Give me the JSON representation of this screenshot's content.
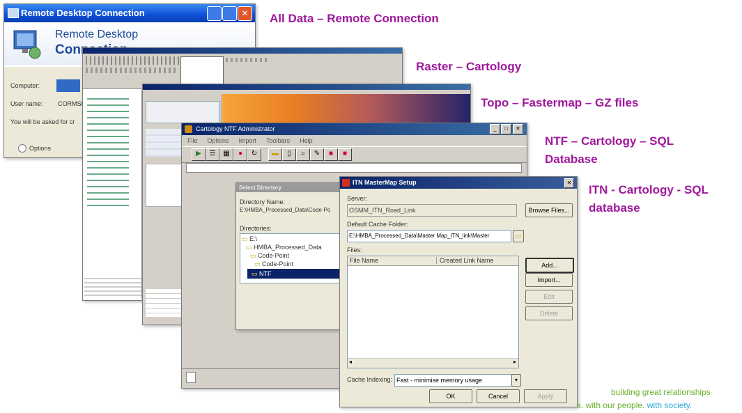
{
  "labels": {
    "rdc": "All Data – Remote Connection",
    "raster": "Raster – Cartology",
    "topo": "Topo – Fastermap – GZ files",
    "ntf_line1": "NTF – Cartology – SQL",
    "ntf_line2": "Database",
    "itn_line1": "ITN - Cartology - SQL",
    "itn_line2": "database"
  },
  "rdc_window": {
    "title": "Remote Desktop Connection",
    "brand_line1": "Remote Desktop",
    "brand_line2": "Connection",
    "computer_label": "Computer:",
    "computer_value": "",
    "username_label": "User name:",
    "username_value": "CORMSE",
    "prompt_text": "You will be asked for cr",
    "options_label": "Options"
  },
  "ntf_window": {
    "title": "Cartology NTF Administrator",
    "menu": [
      "File",
      "Options",
      "Import",
      "Toolbars",
      "Help"
    ]
  },
  "select_dir": {
    "title": "Select Directory",
    "dir_name_label": "Directory Name:",
    "dir_name_value": "E:\\HMBA_Processed_Data\\Code-Po",
    "dirs_label": "Directories:",
    "tree": [
      "E:\\",
      "HMBA_Processed_Data",
      "Code-Point",
      "Code-Point",
      "NTF"
    ]
  },
  "itn_window": {
    "title": "ITN MasterMap Setup",
    "server_label": "Server:",
    "server_value": "OSMM_ITN_Road_Link",
    "browse_label": "Browse Files...",
    "cache_label": "Default Cache Folder:",
    "cache_value": "E:\\HMBA_Processed_Data\\Master Map_ITN_link\\Master",
    "files_label": "Files:",
    "col_filename": "File Name",
    "col_created": "Created Link Name",
    "add_label": "Add...",
    "import_label": "Import...",
    "edit_label": "Edit",
    "delete_label": "Delete",
    "cache_indexing_label": "Cache Indexing:",
    "cache_indexing_value": "Fast - minimise memory usage",
    "ok_label": "OK",
    "cancel_label": "Cancel",
    "apply_label": "Apply"
  },
  "tagline": {
    "line1": "building great relationships",
    "line2_a": "s. with our people.",
    "line2_b": "with society."
  },
  "colors": {
    "label_purple": "#a0189c",
    "tag_green": "#6ab02e",
    "tag_blue": "#2aa7d6"
  }
}
